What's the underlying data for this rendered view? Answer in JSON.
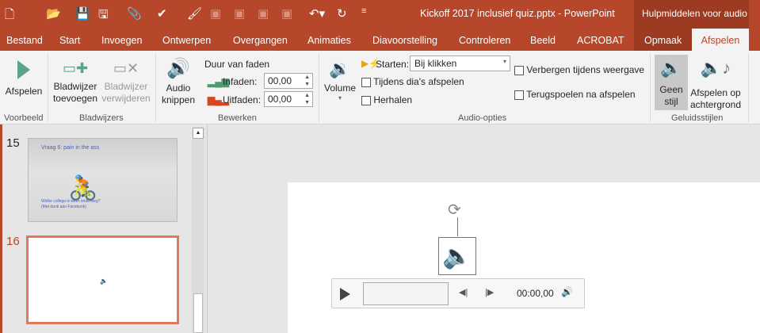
{
  "titlebar": {
    "title": "Kickoff 2017 inclusief quiz.pptx - PowerPoint",
    "context_label": "Hulpmiddelen voor audio"
  },
  "tabs": [
    "Bestand",
    "Start",
    "Invoegen",
    "Ontwerpen",
    "Overgangen",
    "Animaties",
    "Diavoorstelling",
    "Controleren",
    "Beeld",
    "ACROBAT",
    "Opmaak"
  ],
  "active_tab": "Afspelen",
  "ribbon": {
    "voorbeeld": {
      "play": "Afspelen",
      "group": "Voorbeeld"
    },
    "bladwijzers": {
      "add1": "Bladwijzer",
      "add2": "toevoegen",
      "rem1": "Bladwijzer",
      "rem2": "verwijderen",
      "group": "Bladwijzers"
    },
    "bewerken": {
      "trim1": "Audio",
      "trim2": "knippen",
      "fade_title": "Duur van faden",
      "fade_in": "Infaden:",
      "fade_in_value": "00,00",
      "fade_out": "Uitfaden:",
      "fade_out_value": "00,00",
      "group": "Bewerken"
    },
    "audio_opties": {
      "volume": "Volume",
      "start_label": "Starten:",
      "start_value": "Bij klikken",
      "across": "Tijdens dia's afspelen",
      "loop": "Herhalen",
      "hide": "Verbergen tijdens weergave",
      "rewind": "Terugspoelen na afspelen",
      "group": "Audio-opties"
    },
    "stijlen": {
      "none1": "Geen",
      "none2": "stijl",
      "bg1": "Afspelen op",
      "bg2": "achtergrond",
      "group": "Geluidsstijlen"
    }
  },
  "slides": [
    {
      "num": "15",
      "title": "Vraag 6: pain in the ass",
      "body1": "Welke collega is weer onderweg?",
      "body2": "(Met dank aan Facebook)"
    },
    {
      "num": "16"
    }
  ],
  "player": {
    "time": "00:00,00"
  },
  "colors": {
    "accent": "#b7472a",
    "context": "#9c3b22",
    "selected_border": "#e07a5f"
  }
}
